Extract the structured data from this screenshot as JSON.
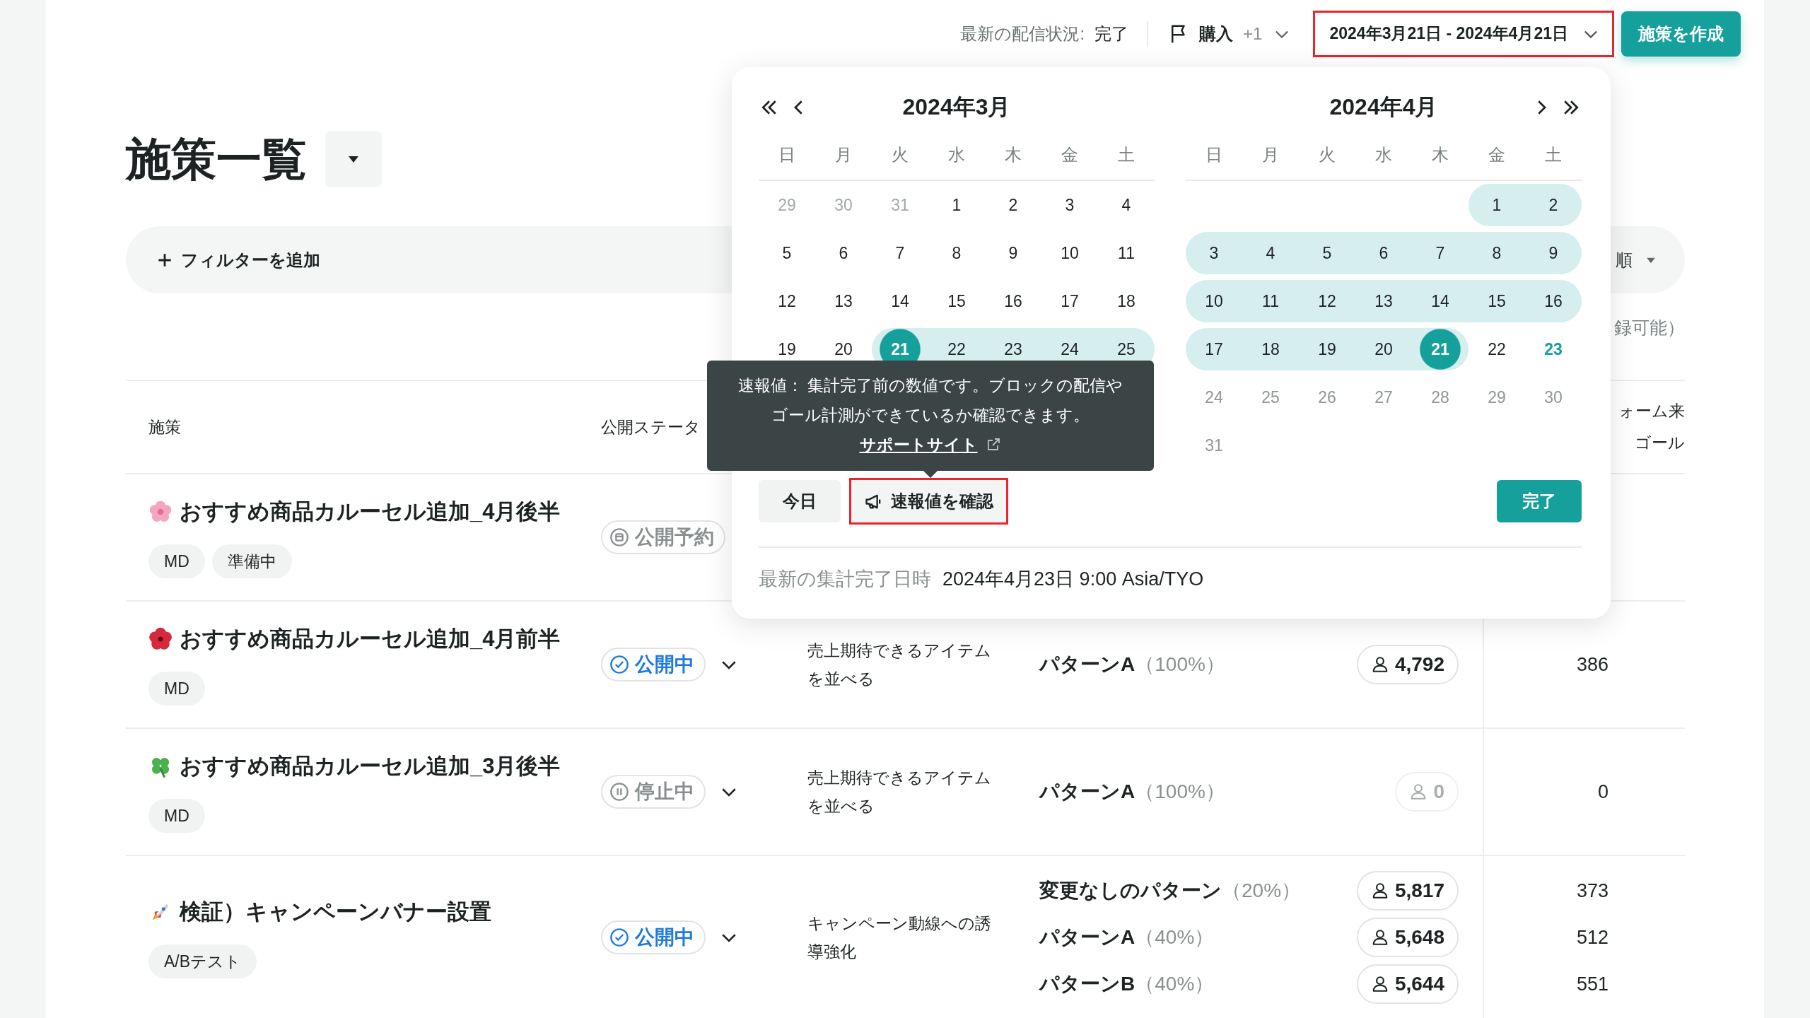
{
  "top_bar": {
    "status_label": "最新の配信状況:",
    "status_value": "完了",
    "goal_filter": {
      "label": "購入",
      "extra": "+1"
    },
    "date_range": "2024年3月21日 - 2024年4月21日",
    "create_button": "施策を作成"
  },
  "page_title": "施策一覧",
  "filter_bar": {
    "add_filter": "フィルターを追加",
    "sort_label": "順"
  },
  "note": "録可能）",
  "table": {
    "columns": [
      {
        "label": "施策"
      },
      {
        "label": "公開ステータ"
      }
    ],
    "goal_header": [
      "ォーム来",
      "ゴール"
    ],
    "rows": [
      {
        "name": "おすすめ商品カルーセル追加_4月後半",
        "tags": [
          "MD",
          "準備中"
        ],
        "status": {
          "label": "公開予約",
          "kind": "scheduled"
        },
        "menu": false
      },
      {
        "name": "おすすめ商品カルーセル追加_4月前半",
        "tags": [
          "MD"
        ],
        "status": {
          "label": "公開中",
          "kind": "live"
        },
        "menu": true,
        "description": "売上期待できるアイテムを並べる",
        "patterns": [
          {
            "name": "パターンA",
            "share": "（100%）",
            "users": "4,792",
            "goal": "386",
            "dimmed": false
          }
        ]
      },
      {
        "name": "おすすめ商品カルーセル追加_3月後半",
        "tags": [
          "MD"
        ],
        "status": {
          "label": "停止中",
          "kind": "paused"
        },
        "menu": true,
        "description": "売上期待できるアイテムを並べる",
        "patterns": [
          {
            "name": "パターンA",
            "share": "（100%）",
            "users": "0",
            "goal": "0",
            "dimmed": true
          }
        ]
      },
      {
        "name": "検証）キャンペーンバナー設置",
        "tags": [
          "A/Bテスト"
        ],
        "status": {
          "label": "公開中",
          "kind": "live"
        },
        "menu": true,
        "description": "キャンペーン動線への誘導強化",
        "patterns": [
          {
            "name": "変更なしのパターン",
            "share": "（20%）",
            "users": "5,817",
            "goal": "373",
            "dimmed": false
          },
          {
            "name": "パターンA",
            "share": "（40%）",
            "users": "5,648",
            "goal": "512",
            "dimmed": false
          },
          {
            "name": "パターンB",
            "share": "（40%）",
            "users": "5,644",
            "goal": "551",
            "dimmed": false
          }
        ]
      }
    ]
  },
  "date_picker": {
    "months": [
      {
        "title": "2024年3月",
        "weekdays": [
          "日",
          "月",
          "火",
          "水",
          "木",
          "金",
          "土"
        ],
        "weeks": [
          [
            {
              "day": "29",
              "kind": "outside",
              "in_range": false,
              "selected": false
            },
            {
              "day": "30",
              "kind": "outside",
              "in_range": false,
              "selected": false
            },
            {
              "day": "31",
              "kind": "outside",
              "in_range": false,
              "selected": false
            },
            {
              "day": "1",
              "kind": "normal",
              "in_range": false,
              "selected": false
            },
            {
              "day": "2",
              "kind": "normal",
              "in_range": false,
              "selected": false
            },
            {
              "day": "3",
              "kind": "normal",
              "in_range": false,
              "selected": false
            },
            {
              "day": "4",
              "kind": "normal",
              "in_range": false,
              "selected": false
            }
          ],
          [
            {
              "day": "5",
              "kind": "normal",
              "in_range": false,
              "selected": false
            },
            {
              "day": "6",
              "kind": "normal",
              "in_range": false,
              "selected": false
            },
            {
              "day": "7",
              "kind": "normal",
              "in_range": false,
              "selected": false
            },
            {
              "day": "8",
              "kind": "normal",
              "in_range": false,
              "selected": false
            },
            {
              "day": "9",
              "kind": "normal",
              "in_range": false,
              "selected": false
            },
            {
              "day": "10",
              "kind": "normal",
              "in_range": false,
              "selected": false
            },
            {
              "day": "11",
              "kind": "normal",
              "in_range": false,
              "selected": false
            }
          ],
          [
            {
              "day": "12",
              "kind": "normal",
              "in_range": false,
              "selected": false
            },
            {
              "day": "13",
              "kind": "normal",
              "in_range": false,
              "selected": false
            },
            {
              "day": "14",
              "kind": "normal",
              "in_range": false,
              "selected": false
            },
            {
              "day": "15",
              "kind": "normal",
              "in_range": false,
              "selected": false
            },
            {
              "day": "16",
              "kind": "normal",
              "in_range": false,
              "selected": false
            },
            {
              "day": "17",
              "kind": "normal",
              "in_range": false,
              "selected": false
            },
            {
              "day": "18",
              "kind": "normal",
              "in_range": false,
              "selected": false
            }
          ],
          [
            {
              "day": "19",
              "kind": "normal",
              "in_range": false,
              "selected": false
            },
            {
              "day": "20",
              "kind": "normal",
              "in_range": false,
              "selected": false
            },
            {
              "day": "21",
              "kind": "normal",
              "in_range": true,
              "selected": true
            },
            {
              "day": "22",
              "kind": "normal",
              "in_range": true,
              "selected": false
            },
            {
              "day": "23",
              "kind": "normal",
              "in_range": true,
              "selected": false
            },
            {
              "day": "24",
              "kind": "normal",
              "in_range": true,
              "selected": false
            },
            {
              "day": "25",
              "kind": "normal",
              "in_range": true,
              "selected": false
            }
          ]
        ]
      },
      {
        "title": "2024年4月",
        "weekdays": [
          "日",
          "月",
          "火",
          "水",
          "木",
          "金",
          "土"
        ],
        "weeks": [
          [
            {
              "day": "1",
              "kind": "normal",
              "in_range": true,
              "selected": false
            },
            {
              "day": "2",
              "kind": "normal",
              "in_range": true,
              "selected": false
            }
          ],
          [
            {
              "day": "3",
              "kind": "normal",
              "in_range": true,
              "selected": false
            },
            {
              "day": "4",
              "kind": "normal",
              "in_range": true,
              "selected": false
            },
            {
              "day": "5",
              "kind": "normal",
              "in_range": true,
              "selected": false
            },
            {
              "day": "6",
              "kind": "normal",
              "in_range": true,
              "selected": false
            },
            {
              "day": "7",
              "kind": "normal",
              "in_range": true,
              "selected": false
            },
            {
              "day": "8",
              "kind": "normal",
              "in_range": true,
              "selected": false
            },
            {
              "day": "9",
              "kind": "normal",
              "in_range": true,
              "selected": false
            }
          ],
          [
            {
              "day": "10",
              "kind": "normal",
              "in_range": true,
              "selected": false
            },
            {
              "day": "11",
              "kind": "normal",
              "in_range": true,
              "selected": false
            },
            {
              "day": "12",
              "kind": "normal",
              "in_range": true,
              "selected": false
            },
            {
              "day": "13",
              "kind": "normal",
              "in_range": true,
              "selected": false
            },
            {
              "day": "14",
              "kind": "normal",
              "in_range": true,
              "selected": false
            },
            {
              "day": "15",
              "kind": "normal",
              "in_range": true,
              "selected": false
            },
            {
              "day": "16",
              "kind": "normal",
              "in_range": true,
              "selected": false
            }
          ],
          [
            {
              "day": "17",
              "kind": "normal",
              "in_range": true,
              "selected": false
            },
            {
              "day": "18",
              "kind": "normal",
              "in_range": true,
              "selected": false
            },
            {
              "day": "19",
              "kind": "normal",
              "in_range": true,
              "selected": false
            },
            {
              "day": "20",
              "kind": "normal",
              "in_range": true,
              "selected": false
            },
            {
              "day": "21",
              "kind": "normal",
              "in_range": true,
              "selected": true
            },
            {
              "day": "22",
              "kind": "normal",
              "in_range": false,
              "selected": false
            },
            {
              "day": "23",
              "kind": "today",
              "in_range": false,
              "selected": false
            }
          ],
          [
            {
              "day": "24",
              "kind": "future",
              "in_range": false,
              "selected": false
            },
            {
              "day": "25",
              "kind": "future",
              "in_range": false,
              "selected": false
            },
            {
              "day": "26",
              "kind": "future",
              "in_range": false,
              "selected": false
            },
            {
              "day": "27",
              "kind": "future",
              "in_range": false,
              "selected": false
            },
            {
              "day": "28",
              "kind": "future",
              "in_range": false,
              "selected": false
            },
            {
              "day": "29",
              "kind": "future",
              "in_range": false,
              "selected": false
            },
            {
              "day": "30",
              "kind": "future",
              "in_range": false,
              "selected": false
            }
          ],
          [
            {
              "day": "31",
              "kind": "future",
              "in_range": false,
              "selected": false
            }
          ]
        ]
      }
    ],
    "today_button": "今日",
    "preview_button": "速報値を確認",
    "done_button": "完了",
    "footer_label": "最新の集計完了日時",
    "footer_value": "2024年4月23日 9:00 Asia/TYO"
  },
  "tooltip": {
    "text": "速報値： 集計完了前の数値です。ブロックの配信やゴール計測ができているか確認できます。",
    "link": "サポートサイト"
  }
}
